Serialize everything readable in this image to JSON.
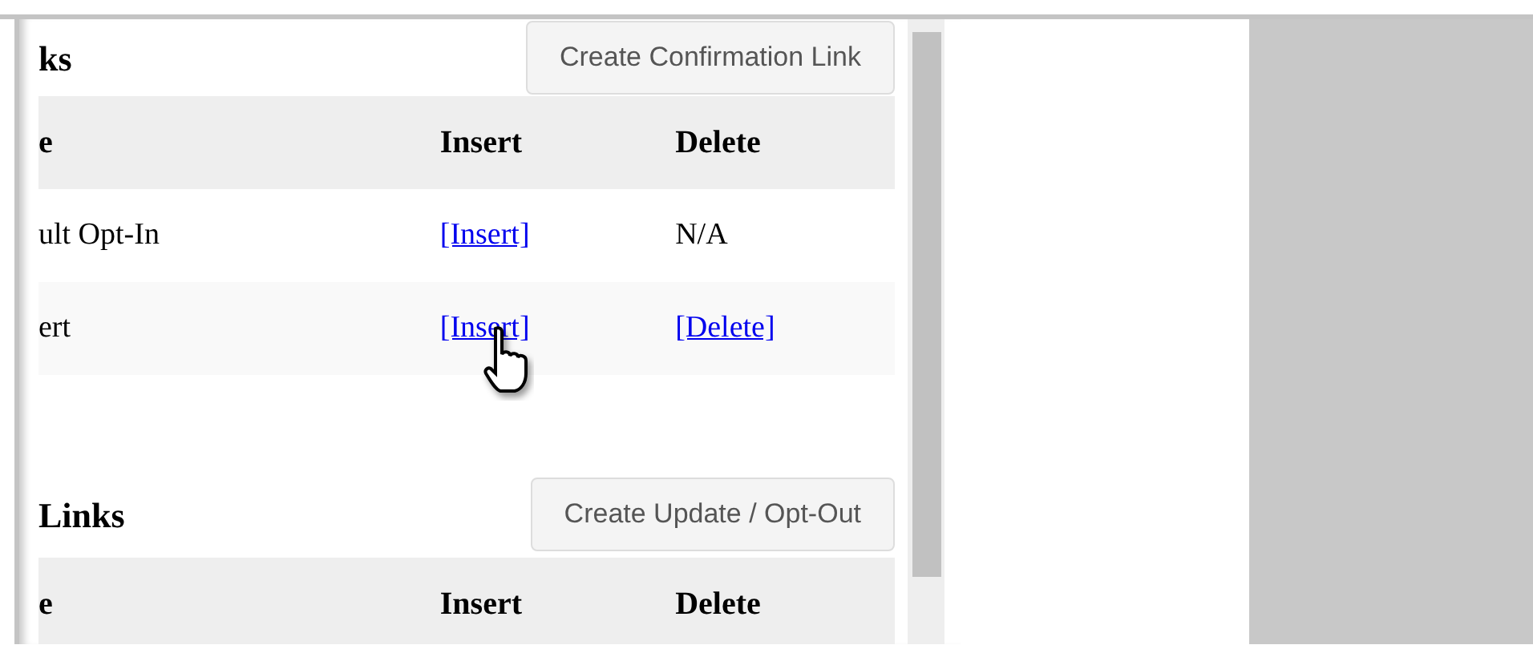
{
  "sections": [
    {
      "heading": "ks",
      "button": "Create Confirmation Link",
      "columns": [
        "e",
        "Insert",
        "Delete"
      ],
      "rows": [
        {
          "name": "ult Opt-In",
          "insert": {
            "text": "[Insert]",
            "kind": "link"
          },
          "delete": {
            "text": "N/A",
            "kind": "text"
          }
        },
        {
          "name": "ert",
          "insert": {
            "text": "[Insert]",
            "kind": "link"
          },
          "delete": {
            "text": "[Delete]",
            "kind": "link"
          }
        }
      ]
    },
    {
      "heading": "Links",
      "button": "Create Update / Opt-Out",
      "columns": [
        "e",
        "Insert",
        "Delete"
      ]
    }
  ]
}
